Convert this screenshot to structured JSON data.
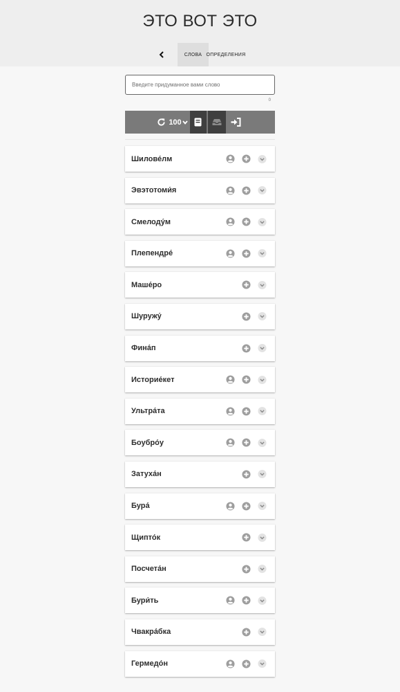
{
  "header": {
    "title": "ЭТО ВОТ ЭТО",
    "tabs": [
      {
        "label": "СЛОВА"
      },
      {
        "label": "ОПРЕДЕЛЕНИЯ"
      }
    ]
  },
  "search": {
    "placeholder": "Введите придуманное вами слово",
    "counter": "0"
  },
  "toolbar": {
    "count": "100"
  },
  "words": [
    {
      "text": "Шилове́лм",
      "author_icon": true
    },
    {
      "text": "Эвэтотоми́я",
      "author_icon": true
    },
    {
      "text": "Смелоду́м",
      "author_icon": true
    },
    {
      "text": "Плепендре́",
      "author_icon": true
    },
    {
      "text": "Маше́ро",
      "author_icon": false
    },
    {
      "text": "Шуружу́",
      "author_icon": false
    },
    {
      "text": "Фина́п",
      "author_icon": false
    },
    {
      "text": "Историе́кет",
      "author_icon": true
    },
    {
      "text": "Ультра́та",
      "author_icon": true
    },
    {
      "text": "Боубро́у",
      "author_icon": true
    },
    {
      "text": "Затуха́н",
      "author_icon": false
    },
    {
      "text": "Бура́",
      "author_icon": true
    },
    {
      "text": "Щипто́к",
      "author_icon": false
    },
    {
      "text": "Посчета́н",
      "author_icon": false
    },
    {
      "text": "Бури́ть",
      "author_icon": true
    },
    {
      "text": "Чвакра́бка",
      "author_icon": false
    },
    {
      "text": "Гермедо́н",
      "author_icon": true
    }
  ],
  "colors": {
    "header_bg": "#eeeeee",
    "toolbar_bg": "#7a7a7a",
    "toolbar_active": "#3f3f3f",
    "icon": "#9e9e9e"
  }
}
